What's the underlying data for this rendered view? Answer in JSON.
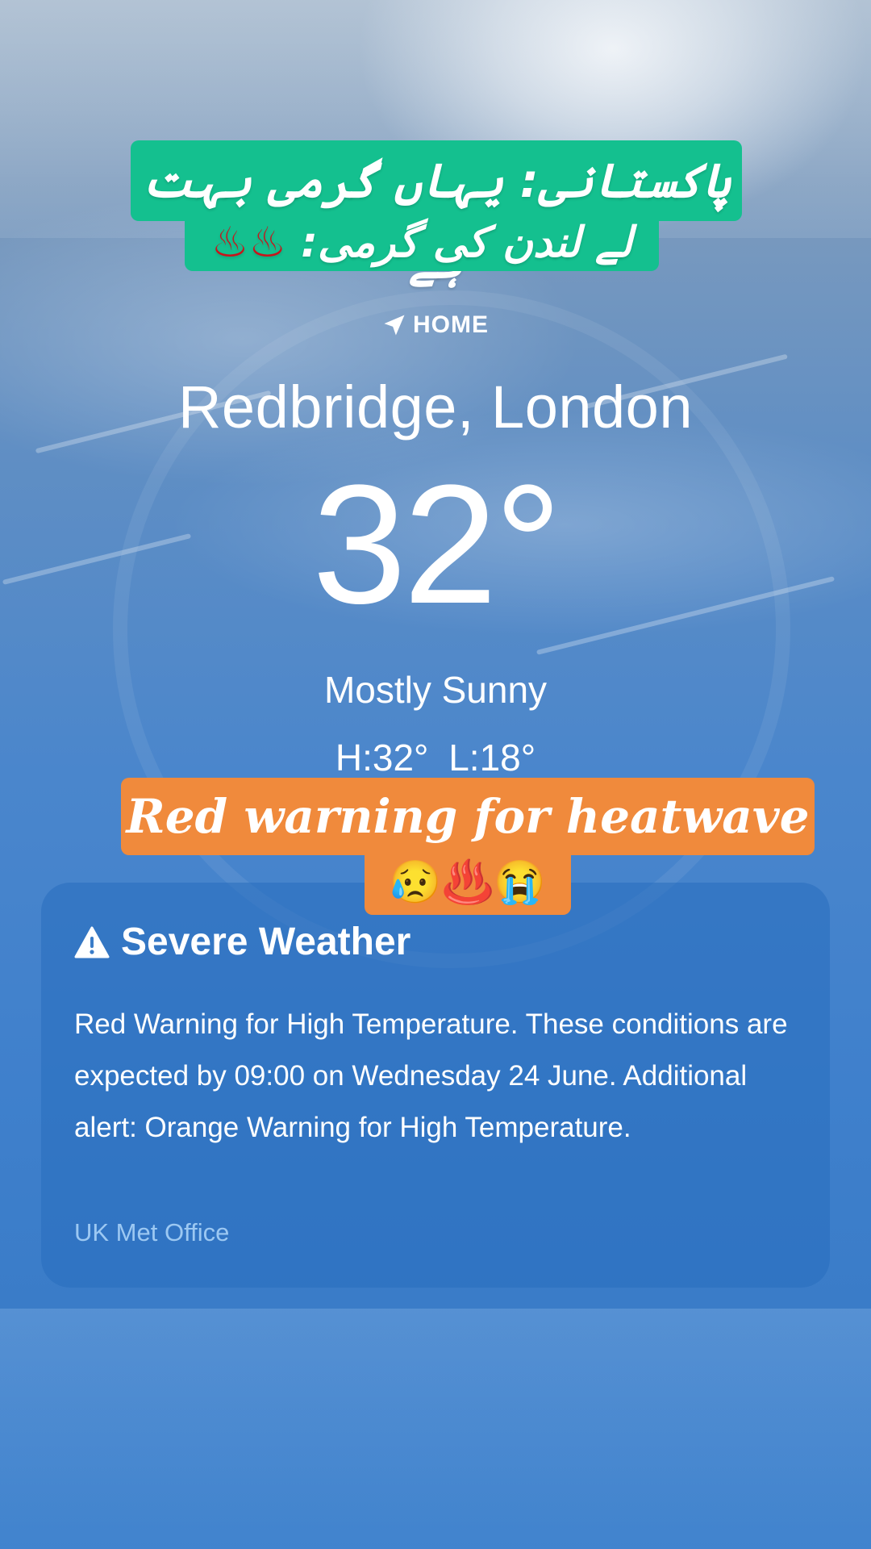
{
  "caption_urdu": {
    "line1": "پاکستانی: یہاں گرمی بہت ہے",
    "line2_text": "لندن کی گرمی:",
    "line2_pre": "لے ",
    "line2_emoji": "♨♨"
  },
  "weather": {
    "location_label": "HOME",
    "city": "Redbridge, London",
    "temperature": "32°",
    "condition": "Mostly Sunny",
    "high_low": "H:32°  L:18°"
  },
  "caption_overlay": {
    "line1": "Red warning for heatwave",
    "line2": "😥♨️😭"
  },
  "alert": {
    "title": "Severe Weather",
    "body": "Red Warning for High Temperature. These conditions are expected by 09:00 on Wednesday 24 June. Additional alert: Orange Warning for High Temperature.",
    "source": "UK Met Office"
  },
  "colors": {
    "urdu_caption_bg": "#14c08f",
    "overlay_caption_bg": "#f08a3c",
    "source_link": "#9cc8f2"
  },
  "icons": [
    "location-arrow-icon",
    "warning-triangle-icon",
    "hot-springs-icon"
  ]
}
